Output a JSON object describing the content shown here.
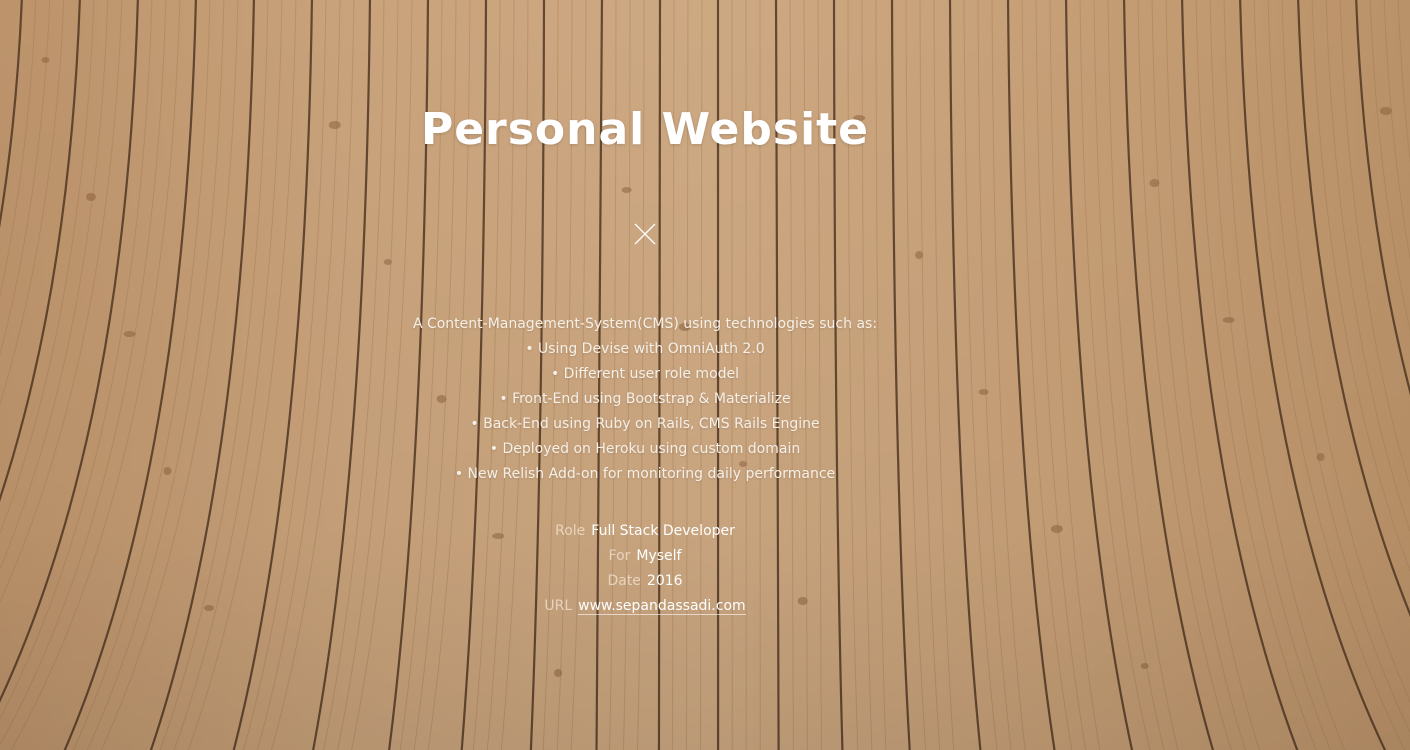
{
  "project": {
    "title": "Personal Website",
    "description_intro": "A Content-Management-System(CMS) using technologies such as:",
    "features": [
      "• Using Devise with OmniAuth 2.0",
      "• Different user role model",
      "• Front-End using Bootstrap & Materialize",
      "• Back-End using Ruby on Rails, CMS Rails Engine",
      "• Deployed on Heroku using custom domain",
      "• New Relish Add-on for monitoring daily performance"
    ],
    "meta": {
      "role_label": "Role",
      "role_value": "Full Stack Developer",
      "for_label": "For",
      "for_value": "Myself",
      "date_label": "Date",
      "date_value": "2016",
      "url_label": "URL",
      "url_value": "www.sepandassadi.com"
    }
  },
  "icons": {
    "close": "close-icon"
  },
  "colors": {
    "wood_light": "#d8b48c",
    "wood_dark": "#b88c62",
    "plank_line": "#5a3e26",
    "text": "#ffffff"
  }
}
